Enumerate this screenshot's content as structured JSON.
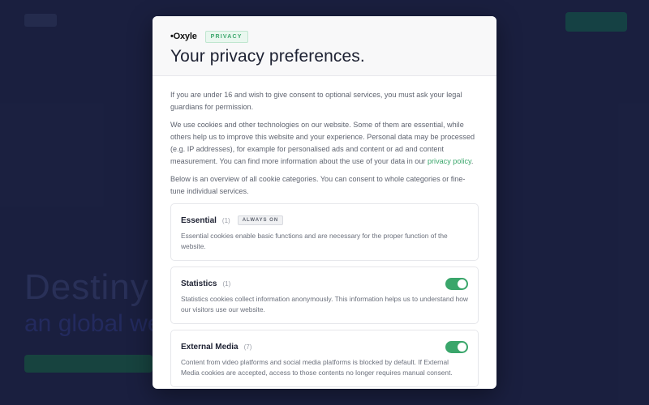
{
  "background": {
    "hero_title": "Destiny for",
    "hero_sub": "an global we"
  },
  "modal": {
    "brand": "•Oxyle",
    "badge": "PRIVACY",
    "title": "Your privacy preferences.",
    "para1": "If you are under 16 and wish to give consent to optional services, you must ask your legal guardians for permission.",
    "para2_text": "We use cookies and other technologies on our website. Some of them are essential, while others help us to improve this website and your experience. Personal data may be processed (e.g. IP addresses), for example for personalised ads and content or ad and content measurement. You can find more information about the use of your data in our ",
    "para2_link": "privacy policy",
    "para2_end": ".",
    "para3": "Below is an overview of all cookie categories. You can consent to whole categories or fine-tune individual services.",
    "categories": [
      {
        "name": "Essential",
        "count": "(1)",
        "pill": "ALWAYS ON",
        "desc": "Essential cookies enable basic functions and are necessary for the proper function of the website."
      },
      {
        "name": "Statistics",
        "count": "(1)",
        "toggle": true,
        "desc": "Statistics cookies collect information anonymously. This information helps us to understand how our visitors use our website."
      },
      {
        "name": "External Media",
        "count": "(7)",
        "toggle": true,
        "desc": "Content from video platforms and social media platforms is blocked by default. If External Media cookies are accepted, access to those contents no longer requires manual consent."
      }
    ]
  },
  "colors": {
    "accent": "#3aa66b",
    "backdrop": "#1e2346"
  },
  "icons": {
    "toggle": "toggle-switch-icon"
  }
}
